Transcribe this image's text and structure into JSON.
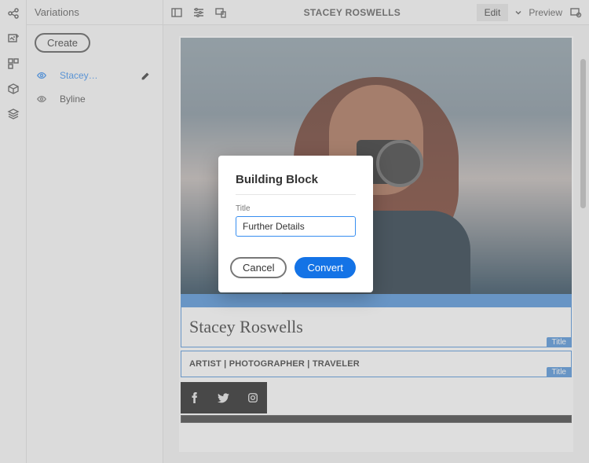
{
  "panel": {
    "title": "Variations",
    "create_label": "Create",
    "items": [
      {
        "label": "Stacey…",
        "active": true
      },
      {
        "label": "Byline",
        "active": false
      }
    ]
  },
  "toolbar": {
    "page_title": "STACEY ROSWELLS",
    "edit_label": "Edit",
    "preview_label": "Preview"
  },
  "content": {
    "heading": "Stacey Roswells",
    "subheading": "ARTIST | PHOTOGRAPHER | TRAVELER",
    "title_chip": "Title"
  },
  "dialog": {
    "heading": "Building Block",
    "field_label": "Title",
    "field_value": "Further Details",
    "cancel_label": "Cancel",
    "confirm_label": "Convert"
  }
}
